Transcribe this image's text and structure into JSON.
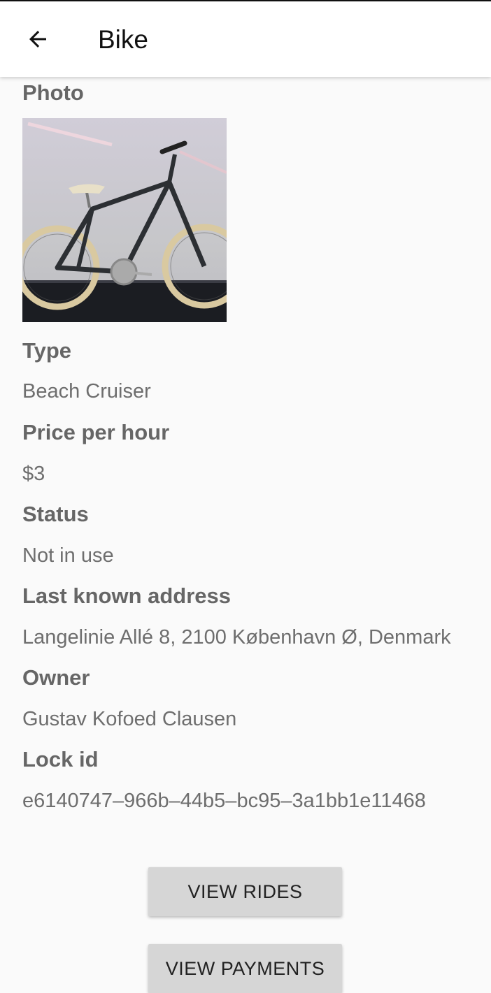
{
  "appbar": {
    "title": "Bike",
    "back_icon": "arrow-left-icon"
  },
  "photo": {
    "label": "Photo",
    "alt": "bike-photo"
  },
  "details": [
    {
      "label": "Type",
      "value": "Beach Cruiser"
    },
    {
      "label": "Price per hour",
      "value": "$3"
    },
    {
      "label": "Status",
      "value": "Not in use"
    },
    {
      "label": "Last known address",
      "value": "Langelinie Allé 8, 2100 København Ø, Denmark"
    },
    {
      "label": "Owner",
      "value": "Gustav Kofoed Clausen"
    },
    {
      "label": "Lock id",
      "value": "e6140747–966b–44b5–bc95–3a1bb1e11468"
    }
  ],
  "buttons": {
    "view_rides": "VIEW RIDES",
    "view_payments": "VIEW PAYMENTS"
  },
  "colors": {
    "background": "#fafafa",
    "appbar": "#ffffff",
    "label_text": "#666666",
    "value_text": "#6e6e6e",
    "button_bg": "#d6d6d6"
  }
}
